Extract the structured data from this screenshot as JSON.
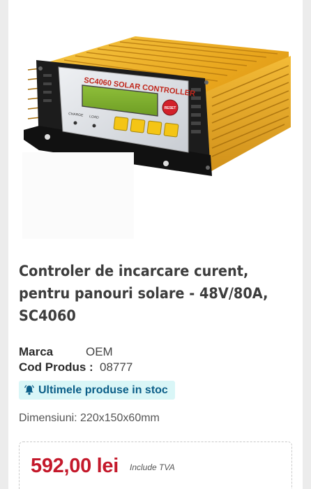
{
  "product": {
    "image": {
      "brand_text": "SC4060 SOLAR CONTROLLER",
      "indicator_labels": [
        "CHARGE",
        "LOAD"
      ],
      "reset_label": "RESET"
    },
    "title": "Controler de incarcare curent, pentru panouri solare - 48V/80A, SC4060",
    "specs": {
      "brand_label": "Marca",
      "brand_value": "OEM",
      "code_label": "Cod Produs :",
      "code_value": "08777"
    },
    "stock_badge": {
      "icon": "bell-icon",
      "text": "Ultimele produse in stoc"
    },
    "dimensions": "Dimensiuni: 220x150x60mm",
    "price": {
      "amount": "592,00 lei",
      "vat_note": "Include TVA"
    }
  },
  "colors": {
    "price": "#c4192b",
    "badge_bg": "#d9f6f7",
    "badge_text": "#0b5e88",
    "heatsink": "#e6a21f"
  }
}
